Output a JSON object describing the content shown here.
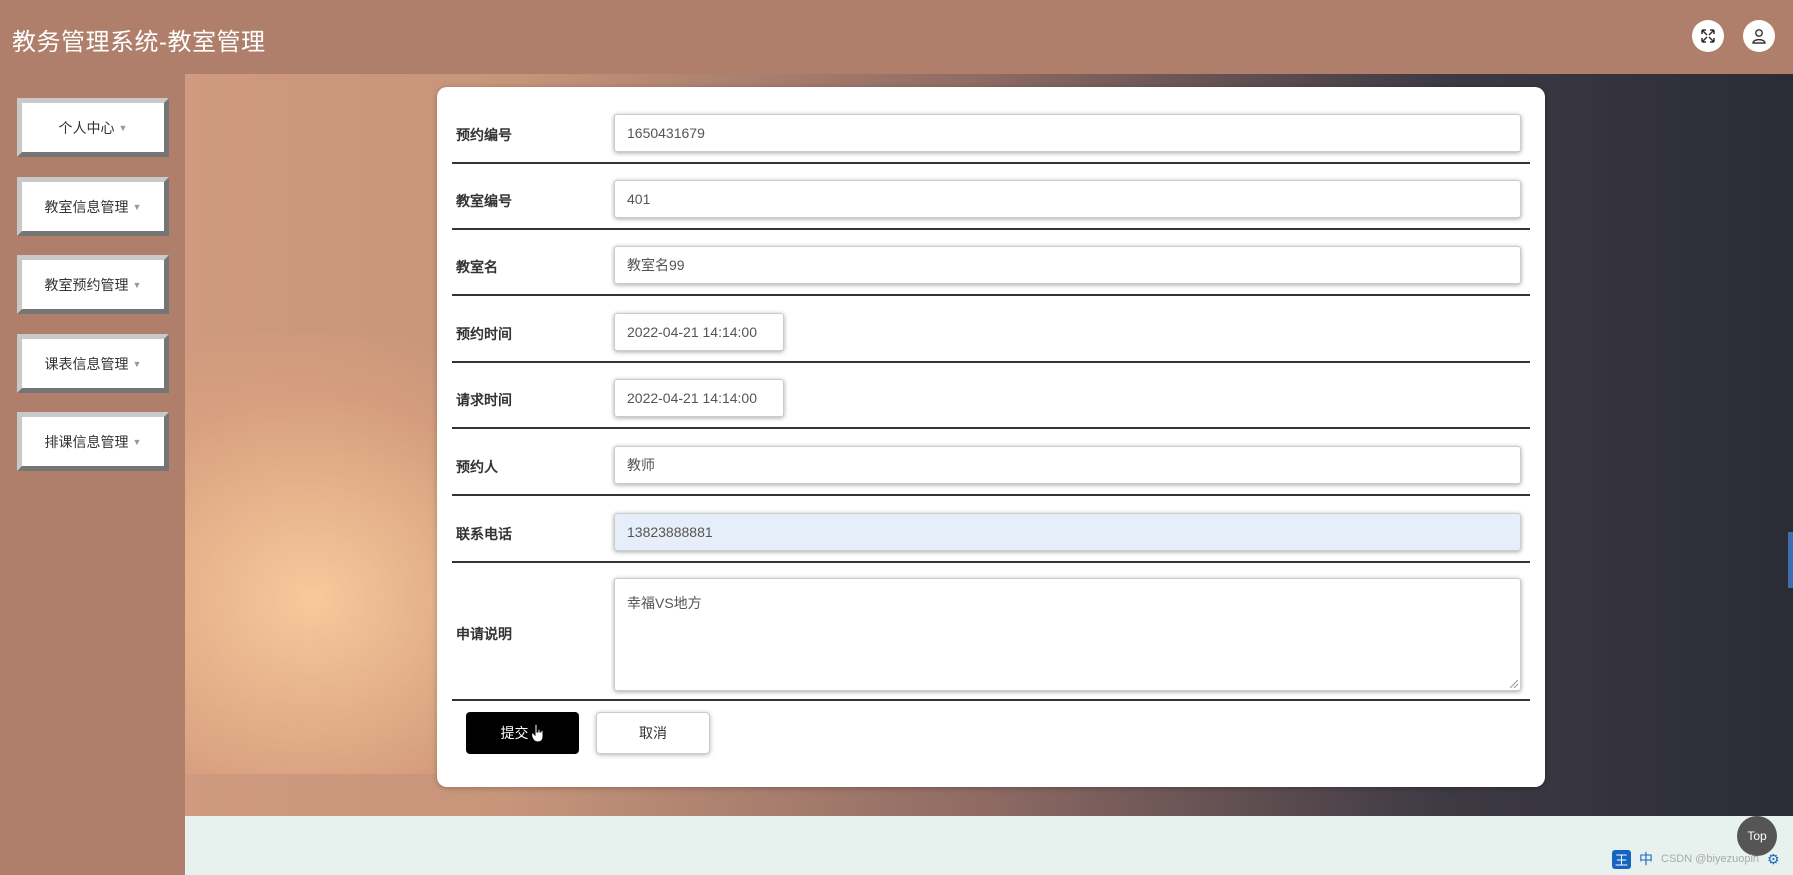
{
  "header": {
    "title": "教务管理系统-教室管理",
    "fullscreen_icon": "expand-icon",
    "user_icon": "user-icon"
  },
  "sidebar": {
    "items": [
      {
        "label": "个人中心"
      },
      {
        "label": "教室信息管理"
      },
      {
        "label": "教室预约管理"
      },
      {
        "label": "课表信息管理"
      },
      {
        "label": "排课信息管理"
      }
    ]
  },
  "form": {
    "fields": [
      {
        "label": "预约编号",
        "value": "1650431679"
      },
      {
        "label": "教室编号",
        "value": "401"
      },
      {
        "label": "教室名",
        "value": "教室名99"
      },
      {
        "label": "预约时间",
        "value": "2022-04-21 14:14:00"
      },
      {
        "label": "请求时间",
        "value": "2022-04-21 14:14:00"
      },
      {
        "label": "预约人",
        "value": "教师"
      },
      {
        "label": "联系电话",
        "value": "13823888881"
      },
      {
        "label": "申请说明",
        "value": "幸福VS地方"
      }
    ],
    "submit_label": "提交",
    "cancel_label": "取消"
  },
  "back_to_top": "Top",
  "tray": {
    "ime_logo": "王",
    "ime_mode": "中",
    "watermark": "CSDN @biyezuopin"
  },
  "colors": {
    "header_bg": "#b07f6b",
    "sidebar_bg": "#b07f6b",
    "submit_bg": "#000000",
    "focused_input_bg": "#e6eefa"
  }
}
